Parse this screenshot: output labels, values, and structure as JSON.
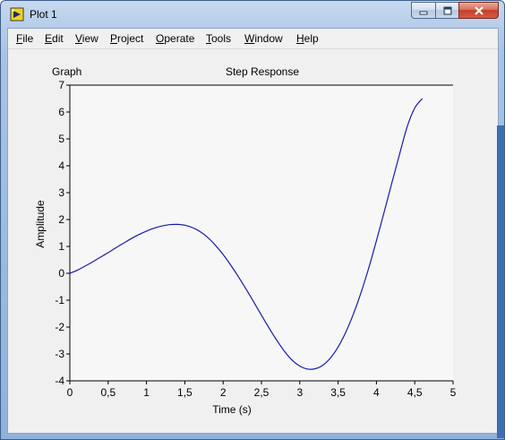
{
  "window": {
    "title": "Plot 1",
    "controls": {
      "minimize": "minimize-icon",
      "maximize": "maximize-icon",
      "close": "close-icon"
    }
  },
  "menu": [
    {
      "id": "file",
      "label": "File",
      "mnemonic": "F",
      "rest": "ile"
    },
    {
      "id": "edit",
      "label": "Edit",
      "mnemonic": "E",
      "rest": "dit"
    },
    {
      "id": "view",
      "label": "View",
      "mnemonic": "V",
      "rest": "iew"
    },
    {
      "id": "project",
      "label": "Project",
      "mnemonic": "P",
      "rest": "roject"
    },
    {
      "id": "operate",
      "label": "Operate",
      "mnemonic": "O",
      "rest": "perate"
    },
    {
      "id": "tools",
      "label": "Tools",
      "mnemonic": "T",
      "rest": "ools"
    },
    {
      "id": "window",
      "label": "Window",
      "mnemonic": "W",
      "rest": "indow"
    },
    {
      "id": "help",
      "label": "Help",
      "mnemonic": "H",
      "rest": "elp"
    }
  ],
  "graph_label": "Graph",
  "colors": {
    "plot_line": "#1a1aa8",
    "plot_bg": "#f7f7f7"
  },
  "chart_data": {
    "type": "line",
    "title": "Step Response",
    "xlabel": "Time (s)",
    "ylabel": "Amplitude",
    "xlim": [
      0,
      5
    ],
    "ylim": [
      -4,
      7
    ],
    "x_ticks": [
      "0",
      "0,5",
      "1",
      "1,5",
      "2",
      "2,5",
      "3",
      "3,5",
      "4",
      "4,5",
      "5"
    ],
    "y_ticks": [
      "-4",
      "-3",
      "-2",
      "-1",
      "0",
      "1",
      "2",
      "3",
      "4",
      "5",
      "6",
      "7"
    ],
    "series": [
      {
        "x": [
          0,
          0.1,
          0.2,
          0.3,
          0.4,
          0.5,
          0.6,
          0.7,
          0.8,
          0.9,
          1.0,
          1.1,
          1.2,
          1.3,
          1.4,
          1.5,
          1.6,
          1.7,
          1.8,
          1.9,
          2.0,
          2.1,
          2.2,
          2.3,
          2.4,
          2.5,
          2.6,
          2.7,
          2.8,
          2.9,
          3.0,
          3.1,
          3.2,
          3.3,
          3.4,
          3.5,
          3.6,
          3.7,
          3.8,
          3.9,
          4.0,
          4.1,
          4.2,
          4.3,
          4.4,
          4.5,
          4.6
        ],
        "y": [
          0,
          0.12,
          0.27,
          0.43,
          0.6,
          0.77,
          0.95,
          1.12,
          1.29,
          1.44,
          1.57,
          1.68,
          1.76,
          1.81,
          1.82,
          1.79,
          1.7,
          1.55,
          1.33,
          1.04,
          0.7,
          0.3,
          -0.13,
          -0.59,
          -1.07,
          -1.56,
          -2.04,
          -2.49,
          -2.9,
          -3.23,
          -3.45,
          -3.56,
          -3.55,
          -3.42,
          -3.15,
          -2.74,
          -2.19,
          -1.51,
          -0.71,
          0.2,
          1.21,
          2.27,
          3.35,
          4.41,
          5.44,
          6.15,
          6.5
        ]
      }
    ]
  }
}
